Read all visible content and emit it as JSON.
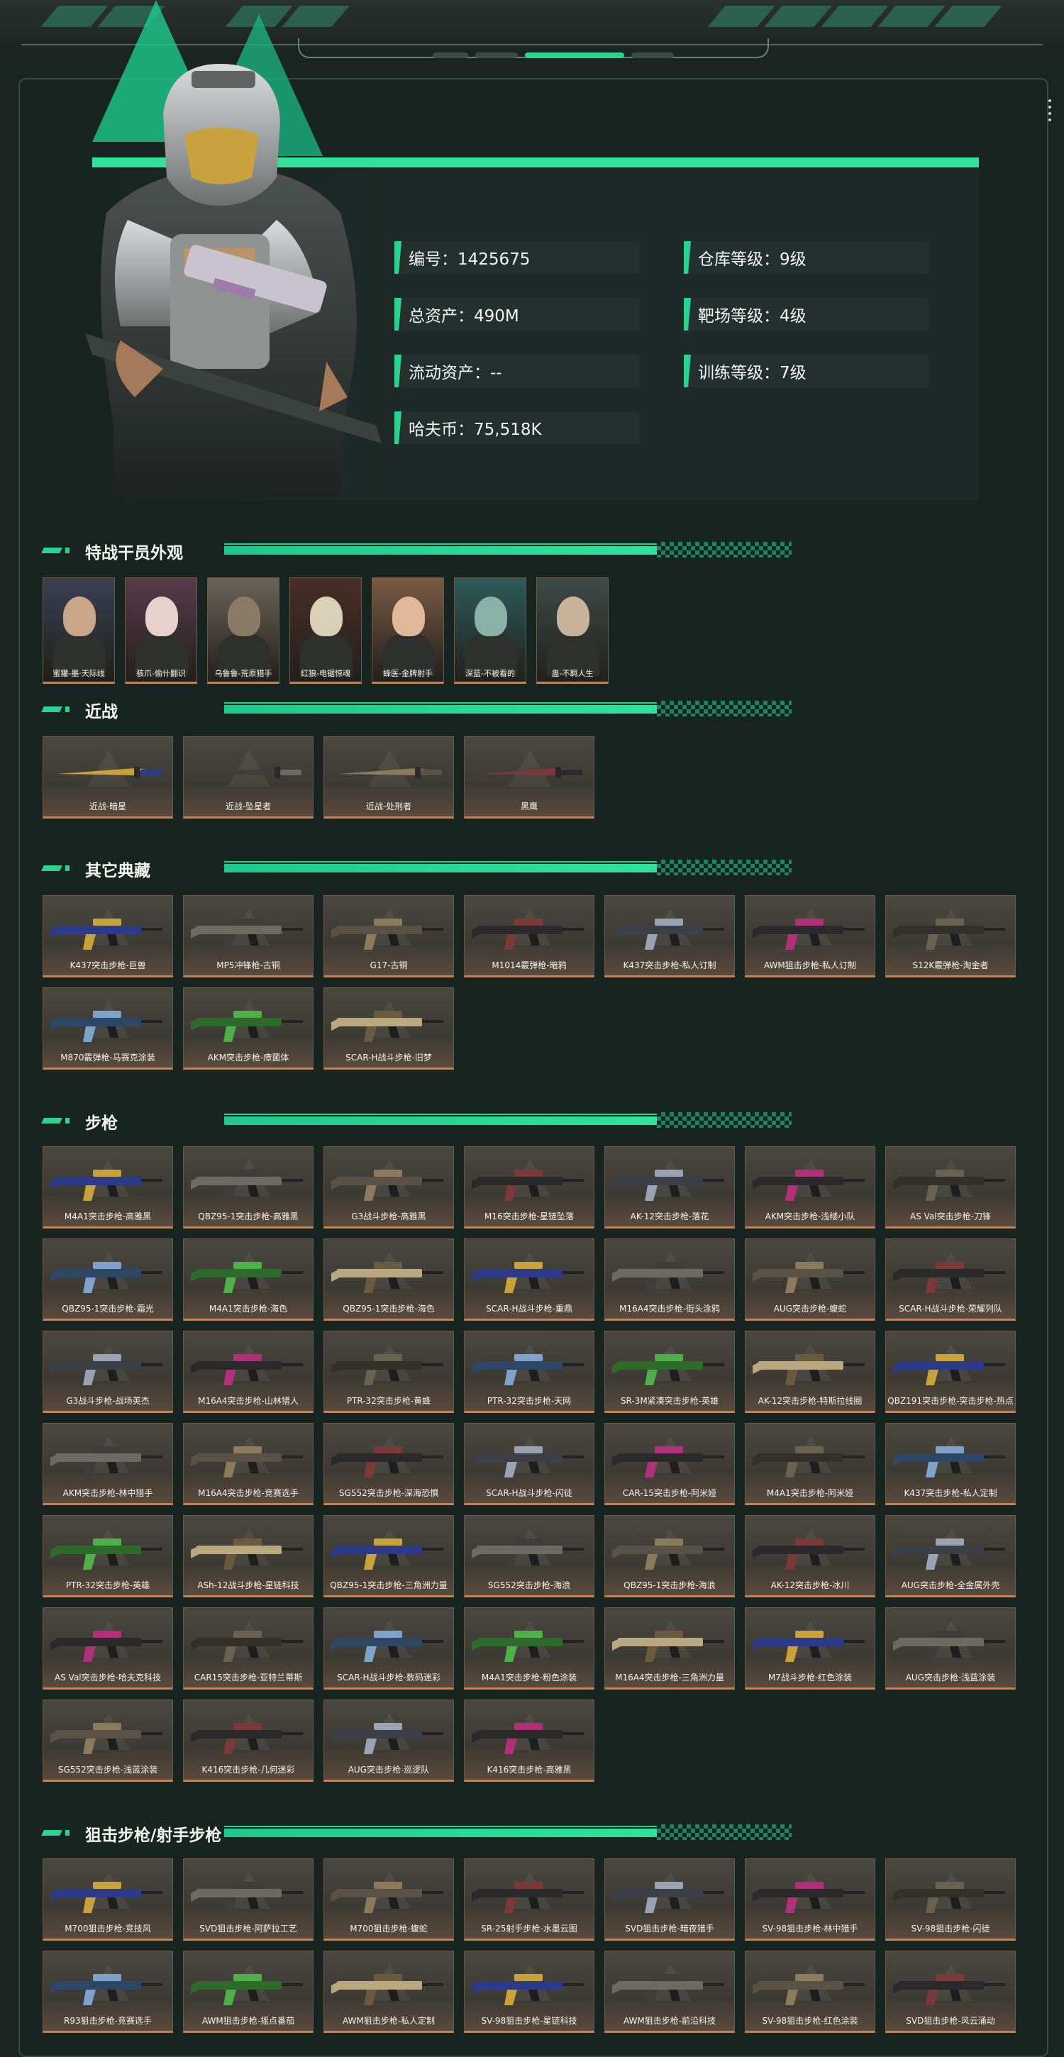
{
  "player": {
    "stats_left": [
      {
        "label": "编号：1425675"
      },
      {
        "label": "总资产：490M"
      },
      {
        "label": "流动资产：--"
      },
      {
        "label": "哈夫币：75,518K"
      }
    ],
    "stats_right": [
      {
        "label": "仓库等级：9级"
      },
      {
        "label": "靶场等级：4级"
      },
      {
        "label": "训练等级：7级"
      }
    ]
  },
  "sections": {
    "operators": {
      "title": "特战干员外观",
      "items": [
        "蜜獾-墨·天际线",
        "骇爪-偷什翻识",
        "乌鲁鲁-荒原猎手",
        "红狼-电锯惊魂",
        "蜂医-金牌射手",
        "深蓝-不被看的",
        "蛊-不羁人生"
      ]
    },
    "melee": {
      "title": "近战",
      "items": [
        "近战-暗星",
        "近战-坠星者",
        "近战-处刑者",
        "黑鹰"
      ]
    },
    "collection": {
      "title": "其它典藏",
      "items": [
        "K437突击步枪-巨兽",
        "MP5冲锋枪-古铜",
        "G17-古铜",
        "M1014霰弹枪-暗鸦",
        "K437突击步枪-私人订制",
        "AWM狙击步枪-私人订制",
        "S12K霰弹枪-淘金者",
        "M870霰弹枪-马赛克涂装",
        "AKM突击步枪-瘴菌体",
        "SCAR-H战斗步枪-旧梦"
      ]
    },
    "rifles": {
      "title": "步枪",
      "items": [
        "M4A1突击步枪-高雅黑",
        "QBZ95-1突击步枪-高雅黑",
        "G3战斗步枪-高雅黑",
        "M16突击步枪-星链坠落",
        "AK-12突击步枪-落花",
        "AKM突击步枪-浅缕小队",
        "AS Val突击步枪-刀锋",
        "QBZ95-1突击步枪-霜光",
        "M4A1突击步枪-海色",
        "QBZ95-1突击步枪-海色",
        "SCAR-H战斗步枪-重鼎",
        "M16A4突击步枪-街头涂鸦",
        "AUG突击步枪-蝮蛇",
        "SCAR-H战斗步枪-荣耀列队",
        "G3战斗步枪-战场英杰",
        "M16A4突击步枪-山林猎人",
        "PTR-32突击步枪-黄蜂",
        "PTR-32突击步枪-天网",
        "SR-3M紧凑突击步枪-英雄",
        "AK-12突击步枪-特斯拉线圈",
        "QBZ191突击步枪-突击步枪-热点",
        "AKM突击步枪-林中猎手",
        "M16A4突击步枪-竞赛选手",
        "SG552突击步枪-深海恐惧",
        "SCAR-H战斗步枪-闪徒",
        "CAR-15突击步枪-阿米娅",
        "M4A1突击步枪-阿米娅",
        "K437突击步枪-私人定制",
        "PTR-32突击步枪-英雄",
        "ASh-12战斗步枪-星链科技",
        "QBZ95-1突击步枪-三角洲力量",
        "SG552突击步枪-海浪",
        "QBZ95-1突击步枪-海浪",
        "AK-12突击步枪-冰川",
        "AUG突击步枪-全金属外壳",
        "AS Val突击步枪-哈夫克科技",
        "CAR15突击步枪-亚特兰蒂斯",
        "SCAR-H战斗步枪-数码迷彩",
        "M4A1突击步枪-粉色涂装",
        "M16A4突击步枪-三角洲力量",
        "M7战斗步枪-红色涂装",
        "AUG突击步枪-浅蓝涂装",
        "SG552突击步枪-浅蓝涂装",
        "K416突击步枪-几何迷彩",
        "AUG突击步枪-巡逻队",
        "K416突击步枪-高雅黑"
      ]
    },
    "snipers": {
      "title": "狙击步枪/射手步枪",
      "items": [
        "M700狙击步枪-竞技风",
        "SVD狙击步枪-阿萨拉工艺",
        "M700狙击步枪-蝮蛇",
        "SR-25射手步枪-水墨云图",
        "SVD狙击步枪-暗夜猎手",
        "SV-98狙击步枪-林中猎手",
        "SV-98狙击步枪-闪徒",
        "R93狙击步枪-竞赛选手",
        "AWM狙击步枪-摇点番茄",
        "AWM狙击步枪-私人定制",
        "SV-98狙击步枪-星链科技",
        "AWM狙击步枪-前沿科技",
        "SV-98狙击步枪-红色涂装",
        "SVD狙击步枪-风云涌动"
      ]
    }
  },
  "colors": {
    "accent": "#2bd38f",
    "card_border": "#e07a3a",
    "background": "#1a2521"
  }
}
